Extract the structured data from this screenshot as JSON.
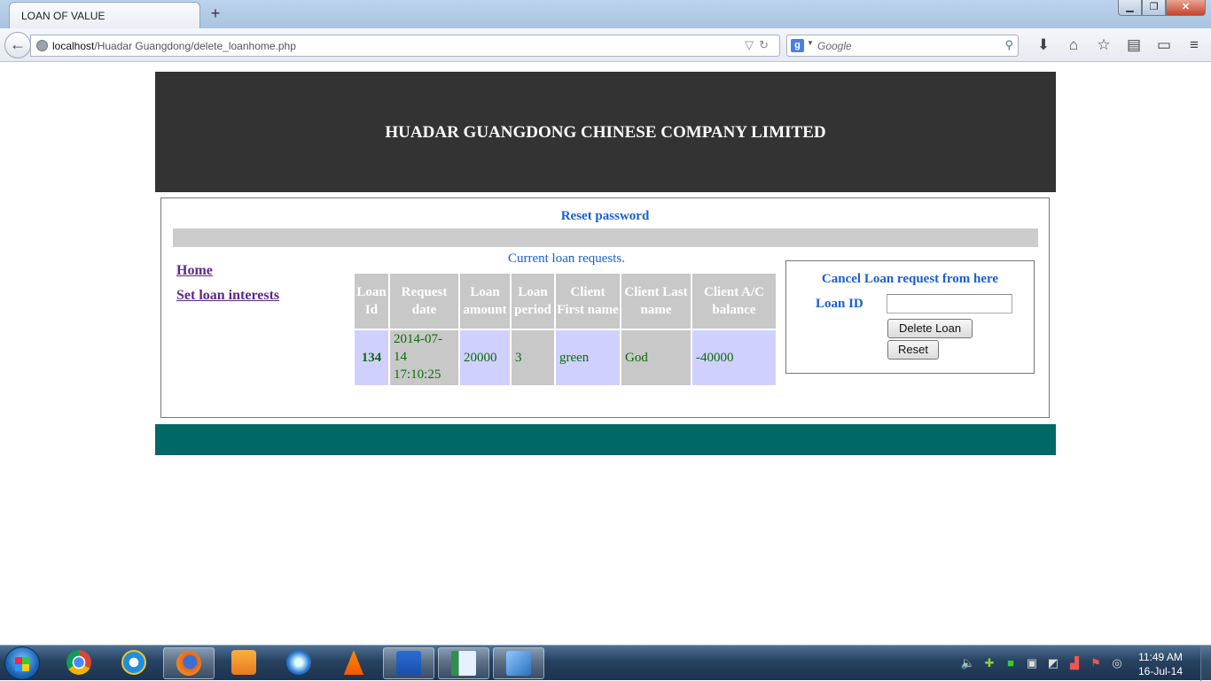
{
  "browser": {
    "tab_title": "LOAN OF VALUE",
    "new_tab_symbol": "+",
    "url_host": "localhost",
    "url_path": "/Huadar Guangdong/delete_loanhome.php",
    "search_placeholder": "Google",
    "window_buttons": {
      "minimize": "▁",
      "maximize": "❐",
      "close": "✕"
    }
  },
  "page": {
    "company_title": "HUADAR GUANGDONG CHINESE COMPANY LIMITED",
    "reset_password_link": "Reset password",
    "sidebar": {
      "home": "Home",
      "set_interests": "Set loan interests"
    },
    "table_caption": "Current loan requests.",
    "table": {
      "headers": [
        "Loan Id",
        "Request date",
        "Loan amount",
        "Loan period",
        "Client First name",
        "Client Last name",
        "Client A/C balance"
      ],
      "rows": [
        {
          "loan_id": "134",
          "request_date": "2014-07-14 17:10:25",
          "loan_amount": "20000",
          "loan_period": "3",
          "first_name": "green",
          "last_name": "God",
          "balance": "-40000"
        }
      ]
    },
    "cancel_panel": {
      "title": "Cancel Loan request from here",
      "loan_id_label": "Loan ID",
      "loan_id_value": "",
      "delete_button": "Delete Loan",
      "reset_button": "Reset"
    }
  },
  "taskbar": {
    "clock_time": "11:49 AM",
    "clock_date": "16-Jul-14"
  },
  "colors": {
    "header_bg": "#333333",
    "footer_bg": "#006966",
    "link_blue": "#1a5fd0",
    "visited_purple": "#5b2a86"
  }
}
